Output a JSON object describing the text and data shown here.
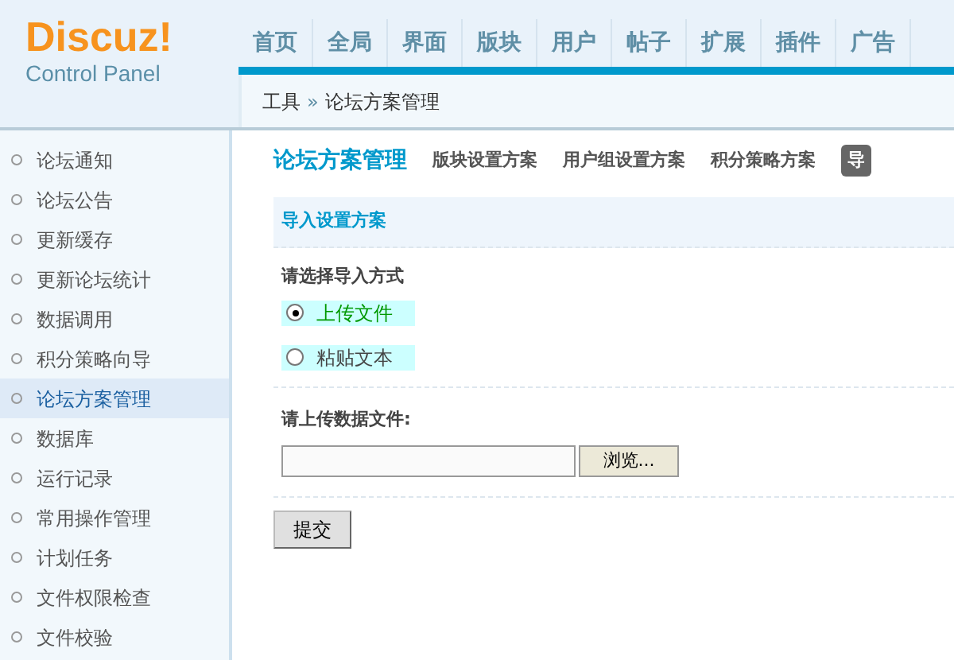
{
  "logo": {
    "title": "Discuz!",
    "subtitle": "Control Panel"
  },
  "nav": [
    {
      "label": "首页",
      "selected": false
    },
    {
      "label": "全局",
      "selected": false
    },
    {
      "label": "界面",
      "selected": false
    },
    {
      "label": "版块",
      "selected": false
    },
    {
      "label": "用户",
      "selected": false
    },
    {
      "label": "帖子",
      "selected": false
    },
    {
      "label": "扩展",
      "selected": false
    },
    {
      "label": "插件",
      "selected": false
    },
    {
      "label": "广告",
      "selected": false
    }
  ],
  "breadcrumb": [
    "工具",
    "论坛方案管理"
  ],
  "breadcrumb_separator": "»",
  "sidebar": {
    "items": [
      {
        "label": "论坛通知",
        "selected": false
      },
      {
        "label": "论坛公告",
        "selected": false
      },
      {
        "label": "更新缓存",
        "selected": false
      },
      {
        "label": "更新论坛统计",
        "selected": false
      },
      {
        "label": "数据调用",
        "selected": false
      },
      {
        "label": "积分策略向导",
        "selected": false
      },
      {
        "label": "论坛方案管理",
        "selected": true
      },
      {
        "label": "数据库",
        "selected": false
      },
      {
        "label": "运行记录",
        "selected": false
      },
      {
        "label": "常用操作管理",
        "selected": false
      },
      {
        "label": "计划任务",
        "selected": false
      },
      {
        "label": "文件权限检查",
        "selected": false
      },
      {
        "label": "文件校验",
        "selected": false
      }
    ]
  },
  "page_title": "论坛方案管理",
  "tabs": [
    {
      "label": "版块设置方案",
      "selected": false
    },
    {
      "label": "用户组设置方案",
      "selected": false
    },
    {
      "label": "积分策略方案",
      "selected": false
    },
    {
      "label": "导",
      "selected": true
    }
  ],
  "section_title": "导入设置方案",
  "import_method": {
    "label": "请选择导入方式",
    "options": [
      {
        "label": "上传文件",
        "selected": true
      },
      {
        "label": "粘贴文本",
        "selected": false
      }
    ]
  },
  "upload": {
    "label": "请上传数据文件:",
    "browse_button": "浏览..."
  },
  "submit_button": "提交"
}
